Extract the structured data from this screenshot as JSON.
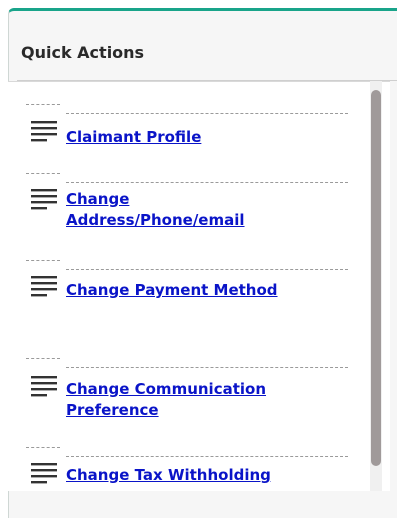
{
  "panel": {
    "title": "Quick Actions",
    "accent_color": "#19a48a",
    "link_color": "#0a14c8"
  },
  "quick_actions": [
    {
      "icon": "list-lines-icon",
      "label": "Claimant Profile"
    },
    {
      "icon": "list-lines-icon",
      "label": "Change Address/Phone/email"
    },
    {
      "icon": "list-lines-icon",
      "label": "Change Payment Method"
    },
    {
      "icon": "list-lines-icon",
      "label": "Change Communication Preference"
    },
    {
      "icon": "list-lines-icon",
      "label": "Change Tax Withholding"
    }
  ]
}
